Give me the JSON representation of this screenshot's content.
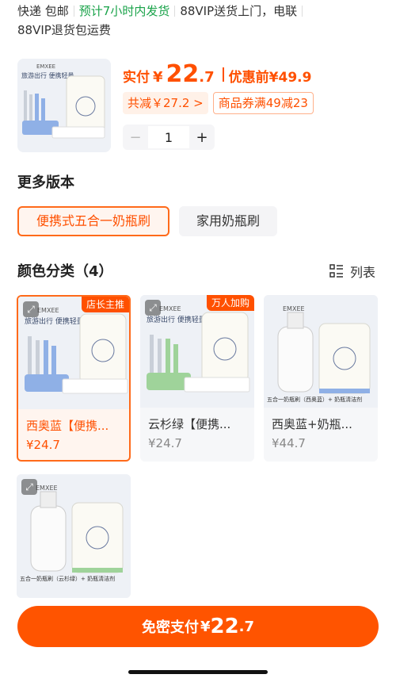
{
  "shipping": {
    "line1_a": "快递 包邮",
    "line1_b": "预计7小时内发货",
    "line1_c": "88VIP送货上门，电联",
    "line2": "88VIP退货包运费"
  },
  "product": {
    "brand": "EMXEE",
    "tagline": "旅游出行 便携轻量"
  },
  "price": {
    "actual_label": "实付",
    "currency": "¥",
    "actual_int": "22",
    "actual_dec": ".7",
    "before_label": "优惠前",
    "before_price": "¥49.9",
    "savings": "共减￥27.2 >",
    "coupon": "商品券满49减23"
  },
  "quantity": {
    "minus": "−",
    "value": "1",
    "plus": "+"
  },
  "versions": {
    "title": "更多版本",
    "items": [
      "便携式五合一奶瓶刷",
      "家用奶瓶刷"
    ]
  },
  "colors": {
    "title": "颜色分类（4）",
    "view_toggle": "列表",
    "items": [
      {
        "badge": "店长主推",
        "name": "西奥蓝【便携...",
        "price": "¥24.7",
        "accent": "#8fb0e6"
      },
      {
        "badge": "万人加购",
        "name": "云杉绿【便携...",
        "price": "¥24.7",
        "accent": "#9fd39a"
      },
      {
        "badge": "",
        "name": "西奥蓝+奶瓶...",
        "price": "¥44.7",
        "caption": "五合一奶瓶刷（西奥蓝）+ 奶瓶清洁剂",
        "accent": "#8fb0e6"
      },
      {
        "badge": "",
        "name": "",
        "price": "",
        "caption": "五合一奶瓶刷（云杉绿）+ 奶瓶清洁剂",
        "accent": "#9fd39a"
      }
    ]
  },
  "pay_button": {
    "label": "免密支付",
    "currency": "¥",
    "int": "22",
    "dec": ".7"
  },
  "colors_theme": {
    "accent": "#ff5000",
    "green": "#1aa34a"
  }
}
